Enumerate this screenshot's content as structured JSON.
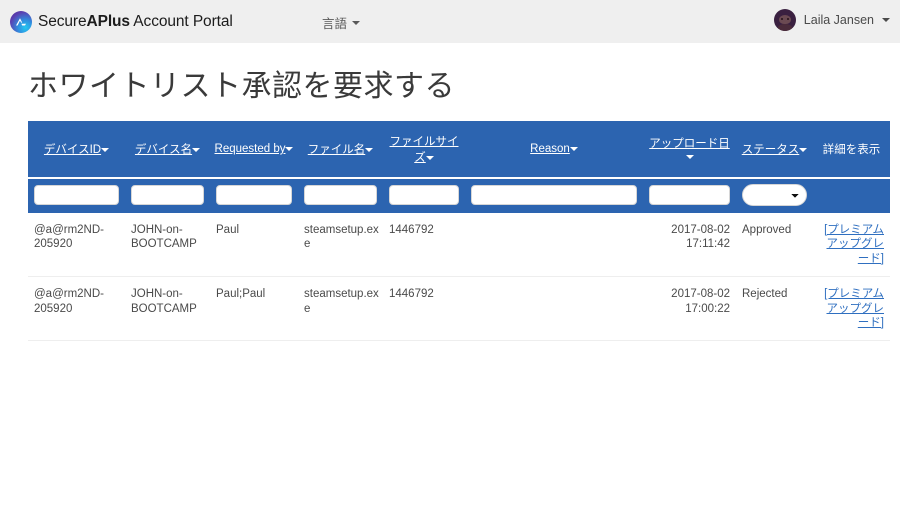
{
  "navbar": {
    "brand_regular": "Secure",
    "brand_bold": "APlus",
    "brand_suffix": " Account Portal",
    "language_label": "言語",
    "user_name": "Laila Jansen"
  },
  "page": {
    "title": "ホワイトリスト承認を要求する"
  },
  "table": {
    "columns": [
      {
        "label": "デバイスID",
        "sortable": true,
        "align": "left"
      },
      {
        "label": "デバイス名",
        "sortable": true,
        "align": "left"
      },
      {
        "label": "Requested by",
        "sortable": true,
        "align": "left"
      },
      {
        "label": "ファイル名",
        "sortable": true,
        "align": "left"
      },
      {
        "label": "ファイルサイズ",
        "sortable": true,
        "align": "left"
      },
      {
        "label": "Reason",
        "sortable": true,
        "align": "left"
      },
      {
        "label": "アップロード日",
        "sortable": true,
        "align": "right"
      },
      {
        "label": "ステータス",
        "sortable": true,
        "align": "left"
      },
      {
        "label": "詳細を表示",
        "sortable": false,
        "align": "left"
      }
    ],
    "filters": {
      "device_id": "",
      "device_name": "",
      "requested_by": "",
      "file_name": "",
      "file_size": "",
      "reason": "",
      "upload_date": "",
      "status": "",
      "status_options": [
        ""
      ]
    },
    "rows": [
      {
        "device_id": "@a@rm2ND-205920",
        "device_name": "JOHN-on-BOOTCAMP",
        "requested_by": "Paul",
        "file_name": "steamsetup.exe",
        "file_size": "1446792",
        "reason": "",
        "upload_date": "2017-08-02 17:11:42",
        "status": "Approved",
        "detail_link": "[プレミアムアップグレード]"
      },
      {
        "device_id": "@a@rm2ND-205920",
        "device_name": "JOHN-on-BOOTCAMP",
        "requested_by": "Paul;Paul",
        "file_name": "steamsetup.exe",
        "file_size": "1446792",
        "reason": "",
        "upload_date": "2017-08-02 17:00:22",
        "status": "Rejected",
        "detail_link": "[プレミアムアップグレード]"
      }
    ]
  },
  "colors": {
    "header_blue": "#2c64b0",
    "link_blue": "#2f6fc0",
    "navbar_bg": "#efefef"
  }
}
